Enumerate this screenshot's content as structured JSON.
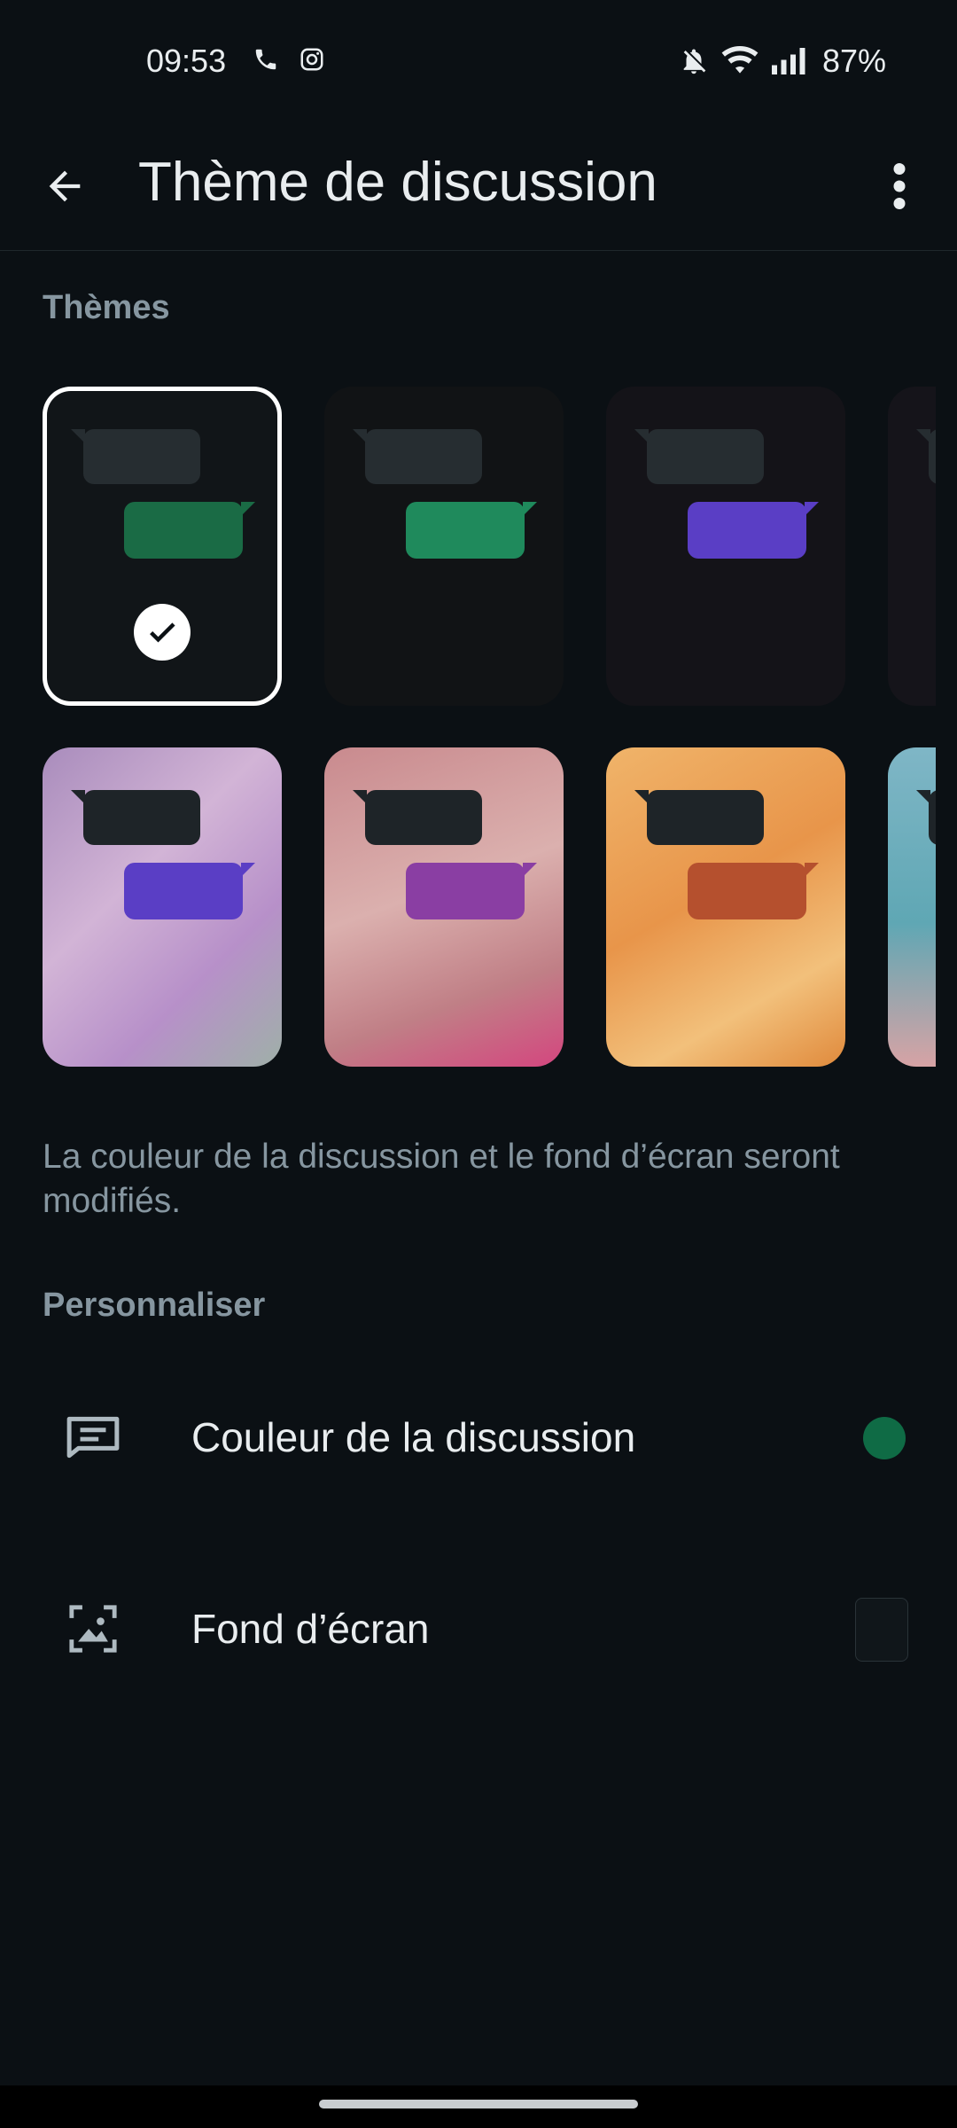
{
  "status_bar": {
    "time": "09:53",
    "battery": "87%",
    "icons_left": [
      "phone-icon",
      "instagram-icon"
    ],
    "icons_right": [
      "bell-off-icon",
      "wifi-icon",
      "signal-icon"
    ]
  },
  "app_bar": {
    "title": "Thème de discussion",
    "back_icon": "arrow-left-icon",
    "menu_icon": "more-vert-icon"
  },
  "themes": {
    "section_title": "Thèmes",
    "row1": [
      {
        "name": "Default dark",
        "bg": "#111518",
        "incoming": "#262d31",
        "outgoing": "#1a6b45",
        "selected": true
      },
      {
        "name": "Dark green",
        "bg": "#111315",
        "incoming": "#262d31",
        "outgoing": "#1f8a5c",
        "selected": false
      },
      {
        "name": "Dark purple",
        "bg": "#141318",
        "incoming": "#262d31",
        "outgoing": "#5a3ec5",
        "selected": false
      },
      {
        "name": "Dark partial",
        "bg": "#15141a",
        "incoming": "#262d31",
        "outgoing": "#5a3ec5",
        "selected": false
      }
    ],
    "row2": [
      {
        "name": "Lilac",
        "bg": "#b89ac7",
        "incoming": "#1e2428",
        "outgoing": "#5a3ec5"
      },
      {
        "name": "Blossom",
        "bg": "#d7a3a5",
        "incoming": "#1e2428",
        "outgoing": "#8a3ea3"
      },
      {
        "name": "Amber",
        "bg": "#e6a356",
        "incoming": "#1e2428",
        "outgoing": "#b5502e"
      },
      {
        "name": "Seaside",
        "bg": "#6aa8b5",
        "incoming": "#1e2428",
        "outgoing": "#2e6b9e"
      }
    ]
  },
  "description": "La couleur de la discussion et le fond d’écran seront modifiés.",
  "customize": {
    "section_title": "Personnaliser",
    "items": [
      {
        "label": "Couleur de la discussion",
        "icon": "chat-color-icon",
        "value_color": "#0f6b45"
      },
      {
        "label": "Fond d’écran",
        "icon": "wallpaper-icon"
      }
    ]
  }
}
